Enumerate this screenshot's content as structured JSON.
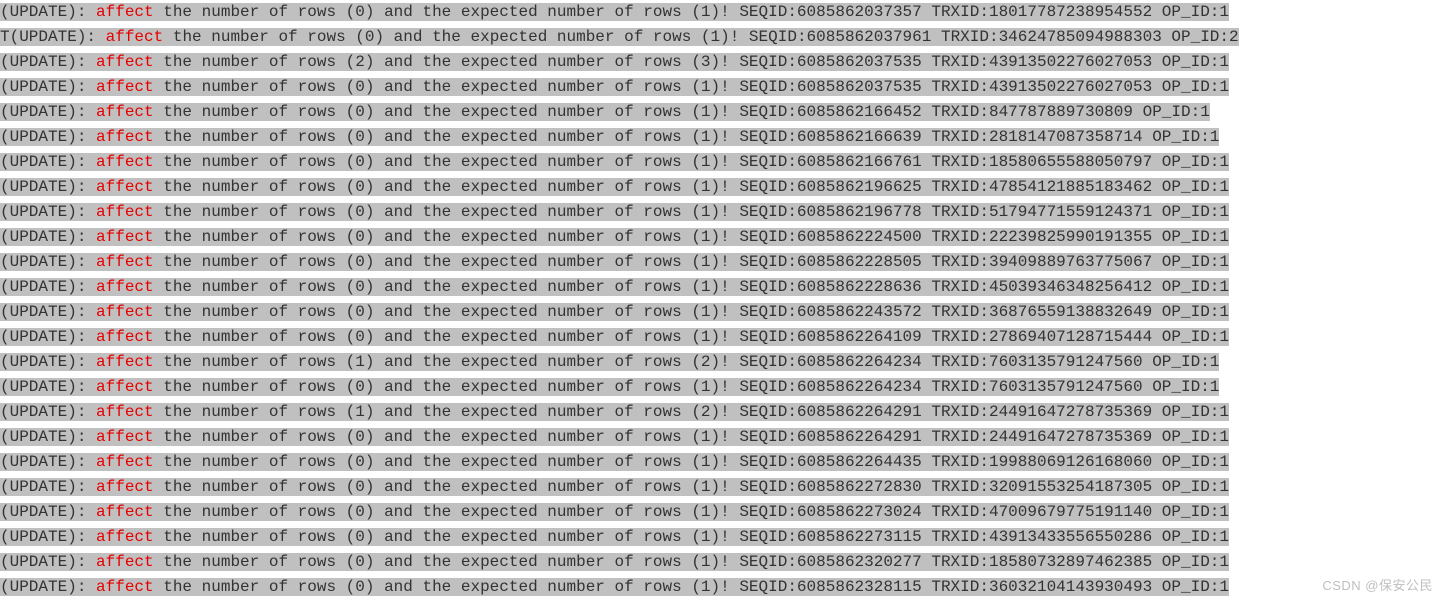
{
  "watermark": "CSDN @保安公民",
  "keyword": "affect",
  "lines": [
    {
      "prefix": "(UPDATE): ",
      "mid": " the number of rows (0) and the expected number of rows (1)! SEQID:6085862037357 TRXID:18017787238954552 OP_ID:1"
    },
    {
      "prefix": "T(UPDATE): ",
      "mid": " the number of rows (0) and the expected number of rows (1)! SEQID:6085862037961 TRXID:34624785094988303 OP_ID:2"
    },
    {
      "prefix": "(UPDATE): ",
      "mid": " the number of rows (2) and the expected number of rows (3)! SEQID:6085862037535 TRXID:43913502276027053 OP_ID:1"
    },
    {
      "prefix": "(UPDATE): ",
      "mid": " the number of rows (0) and the expected number of rows (1)! SEQID:6085862037535 TRXID:43913502276027053 OP_ID:1"
    },
    {
      "prefix": "(UPDATE): ",
      "mid": " the number of rows (0) and the expected number of rows (1)! SEQID:6085862166452 TRXID:847787889730809 OP_ID:1"
    },
    {
      "prefix": "(UPDATE): ",
      "mid": " the number of rows (0) and the expected number of rows (1)! SEQID:6085862166639 TRXID:2818147087358714 OP_ID:1"
    },
    {
      "prefix": "(UPDATE): ",
      "mid": " the number of rows (0) and the expected number of rows (1)! SEQID:6085862166761 TRXID:18580655588050797 OP_ID:1"
    },
    {
      "prefix": "(UPDATE): ",
      "mid": " the number of rows (0) and the expected number of rows (1)! SEQID:6085862196625 TRXID:47854121885183462 OP_ID:1"
    },
    {
      "prefix": "(UPDATE): ",
      "mid": " the number of rows (0) and the expected number of rows (1)! SEQID:6085862196778 TRXID:51794771559124371 OP_ID:1"
    },
    {
      "prefix": "(UPDATE): ",
      "mid": " the number of rows (0) and the expected number of rows (1)! SEQID:6085862224500 TRXID:22239825990191355 OP_ID:1"
    },
    {
      "prefix": "(UPDATE): ",
      "mid": " the number of rows (0) and the expected number of rows (1)! SEQID:6085862228505 TRXID:39409889763775067 OP_ID:1"
    },
    {
      "prefix": "(UPDATE): ",
      "mid": " the number of rows (0) and the expected number of rows (1)! SEQID:6085862228636 TRXID:45039346348256412 OP_ID:1"
    },
    {
      "prefix": "(UPDATE): ",
      "mid": " the number of rows (0) and the expected number of rows (1)! SEQID:6085862243572 TRXID:36876559138832649 OP_ID:1"
    },
    {
      "prefix": "(UPDATE): ",
      "mid": " the number of rows (0) and the expected number of rows (1)! SEQID:6085862264109 TRXID:27869407128715444 OP_ID:1"
    },
    {
      "prefix": "(UPDATE): ",
      "mid": " the number of rows (1) and the expected number of rows (2)! SEQID:6085862264234 TRXID:7603135791247560 OP_ID:1"
    },
    {
      "prefix": "(UPDATE): ",
      "mid": " the number of rows (0) and the expected number of rows (1)! SEQID:6085862264234 TRXID:7603135791247560 OP_ID:1"
    },
    {
      "prefix": "(UPDATE): ",
      "mid": " the number of rows (1) and the expected number of rows (2)! SEQID:6085862264291 TRXID:24491647278735369 OP_ID:1"
    },
    {
      "prefix": "(UPDATE): ",
      "mid": " the number of rows (0) and the expected number of rows (1)! SEQID:6085862264291 TRXID:24491647278735369 OP_ID:1"
    },
    {
      "prefix": "(UPDATE): ",
      "mid": " the number of rows (0) and the expected number of rows (1)! SEQID:6085862264435 TRXID:19988069126168060 OP_ID:1"
    },
    {
      "prefix": "(UPDATE): ",
      "mid": " the number of rows (0) and the expected number of rows (1)! SEQID:6085862272830 TRXID:32091553254187305 OP_ID:1"
    },
    {
      "prefix": "(UPDATE): ",
      "mid": " the number of rows (0) and the expected number of rows (1)! SEQID:6085862273024 TRXID:47009679775191140 OP_ID:1"
    },
    {
      "prefix": "(UPDATE): ",
      "mid": " the number of rows (0) and the expected number of rows (1)! SEQID:6085862273115 TRXID:43913433556550286 OP_ID:1"
    },
    {
      "prefix": "(UPDATE): ",
      "mid": " the number of rows (0) and the expected number of rows (1)! SEQID:6085862320277 TRXID:18580732897462385 OP_ID:1"
    },
    {
      "prefix": "(UPDATE): ",
      "mid": " the number of rows (0) and the expected number of rows (1)! SEQID:6085862328115 TRXID:36032104143930493 OP_ID:1"
    }
  ]
}
